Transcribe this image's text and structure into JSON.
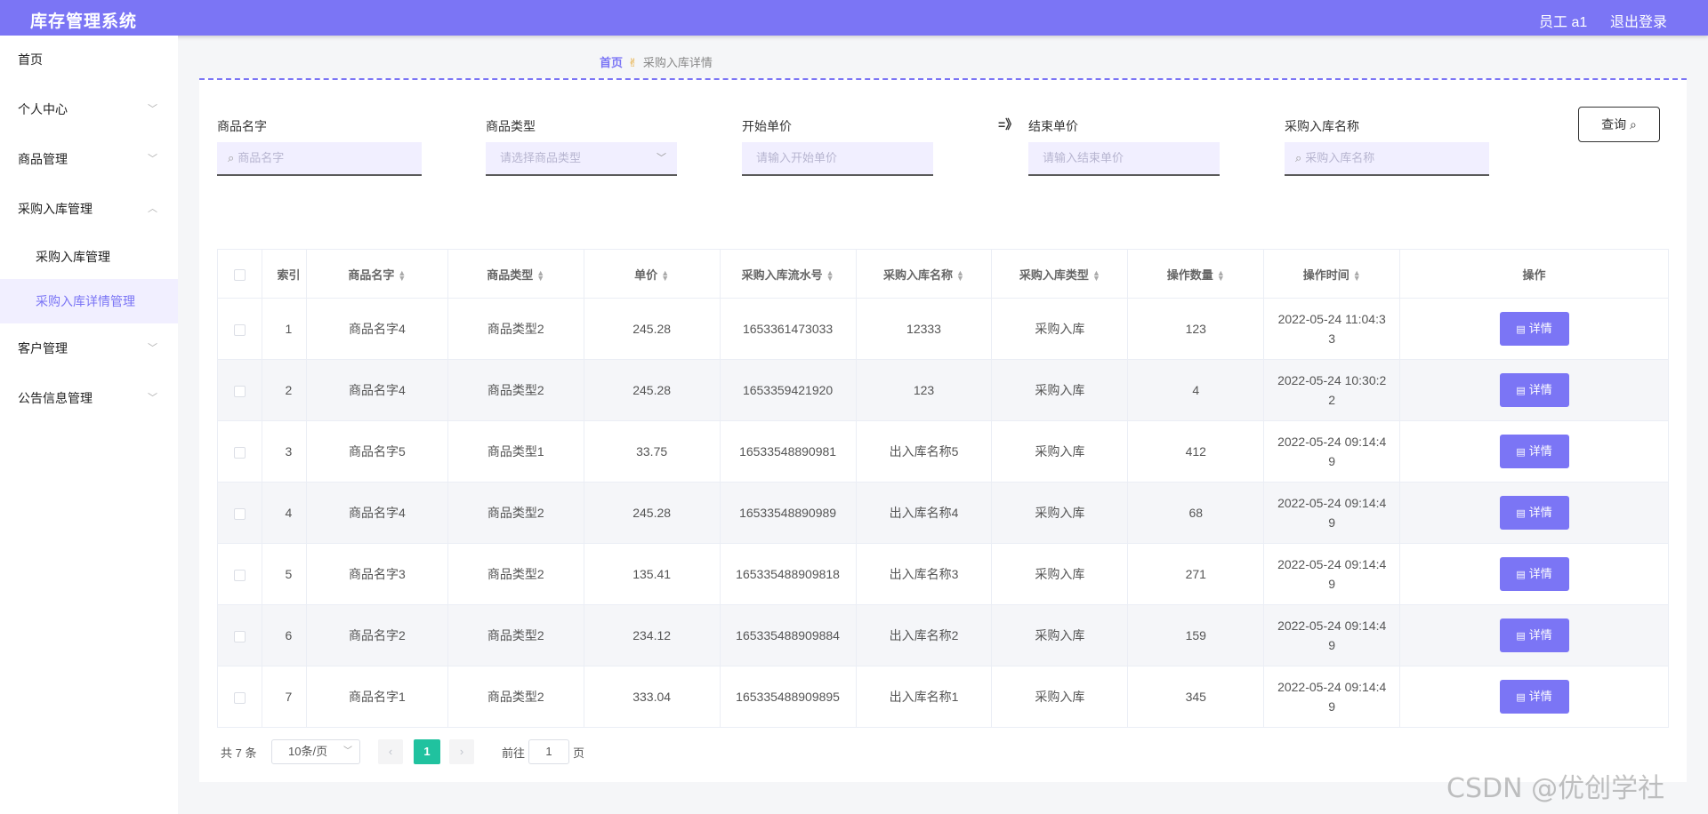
{
  "header": {
    "app_title": "库存管理系统",
    "user": "员工 a1",
    "logout": "退出登录"
  },
  "sidebar": {
    "items": [
      {
        "label": "首页"
      },
      {
        "label": "个人中心"
      },
      {
        "label": "商品管理"
      },
      {
        "label": "采购入库管理"
      },
      {
        "label": "客户管理"
      },
      {
        "label": "公告信息管理"
      }
    ],
    "subitems": [
      {
        "label": "采购入库管理"
      },
      {
        "label": "采购入库详情管理"
      }
    ],
    "active": "采购入库详情管理"
  },
  "breadcrumb": {
    "home": "首页",
    "current": "采购入库详情"
  },
  "filters": {
    "goods_name": {
      "label": "商品名字",
      "placeholder": "商品名字"
    },
    "goods_type": {
      "label": "商品类型",
      "placeholder": "请选择商品类型"
    },
    "start_price": {
      "label": "开始单价",
      "placeholder": "请输入开始单价"
    },
    "range_separator": "=》",
    "end_price": {
      "label": "结束单价",
      "placeholder": "请输入结束单价"
    },
    "purchase_name": {
      "label": "采购入库名称",
      "placeholder": "采购入库名称"
    },
    "search_button": "查询"
  },
  "table": {
    "headers": [
      "索引",
      "商品名字",
      "商品类型",
      "单价",
      "采购入库流水号",
      "采购入库名称",
      "采购入库类型",
      "操作数量",
      "操作时间",
      "操作"
    ],
    "detail_label": "详情",
    "rows": [
      {
        "index": "1",
        "name": "商品名字4",
        "type": "商品类型2",
        "price": "245.28",
        "serial": "1653361473033",
        "purchase_name": "12333",
        "purchase_type": "采购入库",
        "qty": "123",
        "time1": "2022-05-24 11:04:3",
        "time2": "3"
      },
      {
        "index": "2",
        "name": "商品名字4",
        "type": "商品类型2",
        "price": "245.28",
        "serial": "1653359421920",
        "purchase_name": "123",
        "purchase_type": "采购入库",
        "qty": "4",
        "time1": "2022-05-24 10:30:2",
        "time2": "2"
      },
      {
        "index": "3",
        "name": "商品名字5",
        "type": "商品类型1",
        "price": "33.75",
        "serial": "16533548890981",
        "purchase_name": "出入库名称5",
        "purchase_type": "采购入库",
        "qty": "412",
        "time1": "2022-05-24 09:14:4",
        "time2": "9"
      },
      {
        "index": "4",
        "name": "商品名字4",
        "type": "商品类型2",
        "price": "245.28",
        "serial": "16533548890989",
        "purchase_name": "出入库名称4",
        "purchase_type": "采购入库",
        "qty": "68",
        "time1": "2022-05-24 09:14:4",
        "time2": "9"
      },
      {
        "index": "5",
        "name": "商品名字3",
        "type": "商品类型2",
        "price": "135.41",
        "serial": "165335488909818",
        "purchase_name": "出入库名称3",
        "purchase_type": "采购入库",
        "qty": "271",
        "time1": "2022-05-24 09:14:4",
        "time2": "9"
      },
      {
        "index": "6",
        "name": "商品名字2",
        "type": "商品类型2",
        "price": "234.12",
        "serial": "165335488909884",
        "purchase_name": "出入库名称2",
        "purchase_type": "采购入库",
        "qty": "159",
        "time1": "2022-05-24 09:14:4",
        "time2": "9"
      },
      {
        "index": "7",
        "name": "商品名字1",
        "type": "商品类型2",
        "price": "333.04",
        "serial": "165335488909895",
        "purchase_name": "出入库名称1",
        "purchase_type": "采购入库",
        "qty": "345",
        "time1": "2022-05-24 09:14:4",
        "time2": "9"
      }
    ]
  },
  "pagination": {
    "total": "共 7 条",
    "page_size": "10条/页",
    "current": "1",
    "goto_label": "前往",
    "goto_value": "1",
    "page_suffix": "页"
  },
  "watermark": "CSDN @优创学社",
  "colors": {
    "accent": "#7b75f5",
    "active_page": "#20c29f"
  },
  "icons": [
    "search-icon",
    "chevron-down-icon",
    "chevron-up-icon",
    "sort-icon",
    "document-icon",
    "hand-icon",
    "chevron-left-icon",
    "chevron-right-icon"
  ]
}
